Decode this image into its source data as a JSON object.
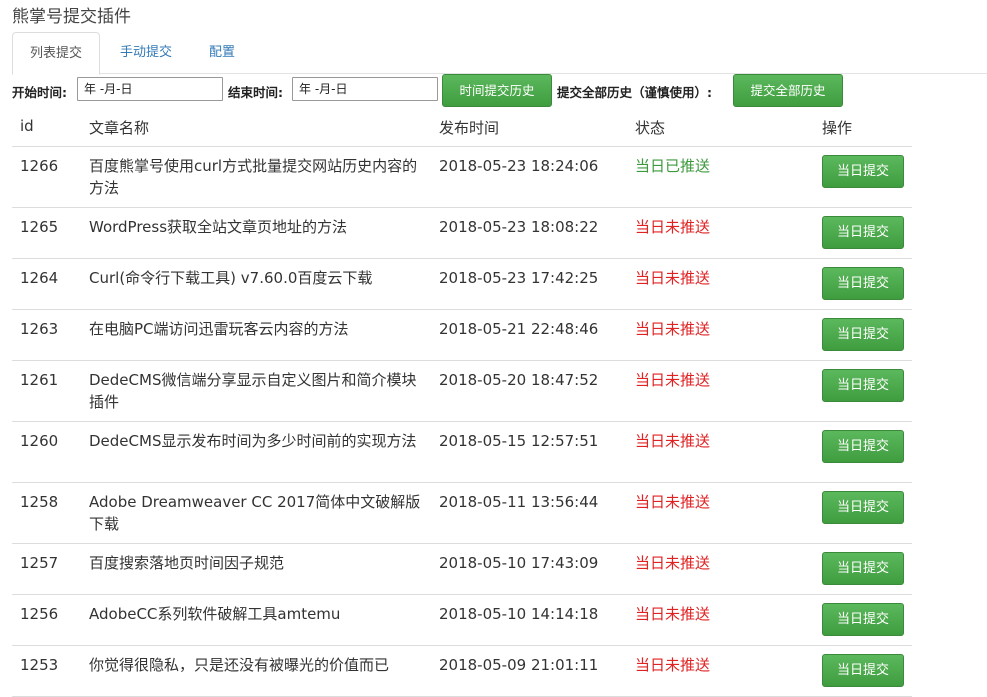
{
  "page": {
    "title": "熊掌号提交插件"
  },
  "tabs": [
    {
      "label": "列表提交",
      "active": true
    },
    {
      "label": "手动提交",
      "active": false
    },
    {
      "label": "配置",
      "active": false
    }
  ],
  "filter": {
    "start_label": "开始时间:",
    "start_value": "年 -月-日",
    "end_label": "结束时间:",
    "end_value": "年 -月-日",
    "time_submit_button": "时间提交历史",
    "all_label": "提交全部历史（谨慎使用）:",
    "all_submit_button": "提交全部历史"
  },
  "table": {
    "headers": {
      "id": "id",
      "title": "文章名称",
      "time": "发布时间",
      "status": "状态",
      "action": "操作"
    },
    "rows": [
      {
        "id": "1266",
        "title": "百度熊掌号使用curl方式批量提交网站历史内容的方法",
        "time": "2018-05-23 18:24:06",
        "status": "当日已推送",
        "status_type": "ok",
        "button": "当日提交"
      },
      {
        "id": "1265",
        "title": "WordPress获取全站文章页地址的方法",
        "time": "2018-05-23 18:08:22",
        "status": "当日未推送",
        "status_type": "no",
        "button": "当日提交"
      },
      {
        "id": "1264",
        "title": "Curl(命令行下载工具) v7.60.0百度云下载",
        "time": "2018-05-23 17:42:25",
        "status": "当日未推送",
        "status_type": "no",
        "button": "当日提交"
      },
      {
        "id": "1263",
        "title": "在电脑PC端访问迅雷玩客云内容的方法",
        "time": "2018-05-21 22:48:46",
        "status": "当日未推送",
        "status_type": "no",
        "button": "当日提交"
      },
      {
        "id": "1261",
        "title": "DedeCMS微信端分享显示自定义图片和简介模块插件",
        "time": "2018-05-20 18:47:52",
        "status": "当日未推送",
        "status_type": "no",
        "button": "当日提交"
      },
      {
        "id": "1260",
        "title": "DedeCMS显示发布时间为多少时间前的实现方法",
        "time": "2018-05-15 12:57:51",
        "status": "当日未推送",
        "status_type": "no",
        "button": "当日提交"
      },
      {
        "id": "1258",
        "title": "Adobe Dreamweaver CC 2017简体中文破解版下载",
        "time": "2018-05-11 13:56:44",
        "status": "当日未推送",
        "status_type": "no",
        "button": "当日提交"
      },
      {
        "id": "1257",
        "title": "百度搜索落地页时间因子规范",
        "time": "2018-05-10 17:43:09",
        "status": "当日未推送",
        "status_type": "no",
        "button": "当日提交"
      },
      {
        "id": "1256",
        "title": "AdobeCC系列软件破解工具amtemu",
        "time": "2018-05-10 14:14:18",
        "status": "当日未推送",
        "status_type": "no",
        "button": "当日提交"
      },
      {
        "id": "1253",
        "title": "你觉得很隐私，只是还没有被曝光的价值而已",
        "time": "2018-05-09 21:01:11",
        "status": "当日未推送",
        "status_type": "no",
        "button": "当日提交"
      }
    ]
  },
  "colors": {
    "button_green": "#4cae4c",
    "status_ok": "#3c9a3c",
    "status_no": "#e02222",
    "tab_link": "#337ab7"
  }
}
